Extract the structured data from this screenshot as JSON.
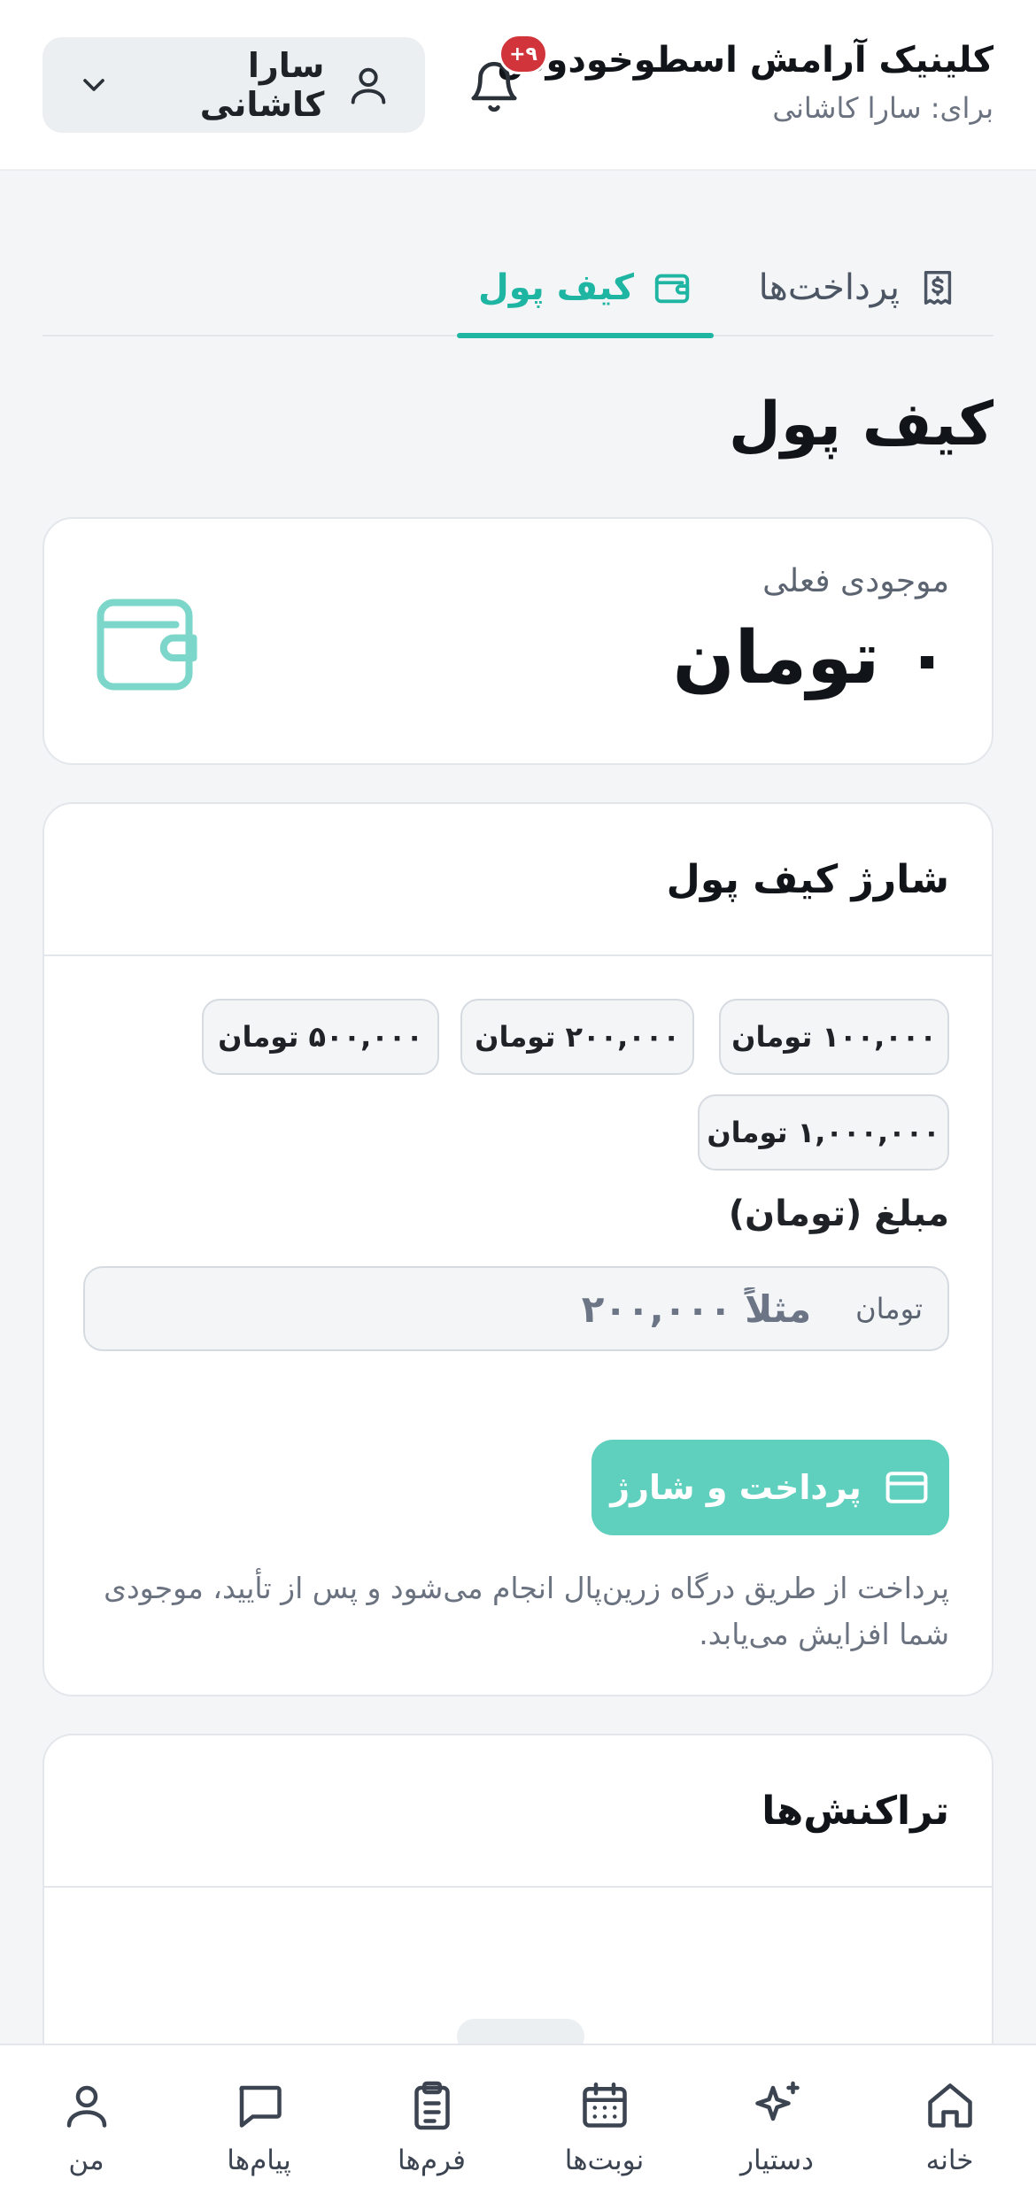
{
  "header": {
    "clinic_name": "کلینیک آرامش اسطوخودوس",
    "for_line": "برای: سارا کاشانی",
    "notification_badge": "۹+",
    "user_name": "سارا کاشانی"
  },
  "tabs": [
    {
      "label": "پرداخت‌ها",
      "icon": "receipt-icon",
      "active": false
    },
    {
      "label": "کیف پول",
      "icon": "wallet-icon",
      "active": true
    }
  ],
  "page_title": "کیف پول",
  "balance": {
    "label": "موجودی فعلی",
    "value": "۰ تومان"
  },
  "charge": {
    "title": "شارژ کیف پول",
    "presets": [
      "۱۰۰,۰۰۰ تومان",
      "۲۰۰,۰۰۰ تومان",
      "۵۰۰,۰۰۰ تومان",
      "۱,۰۰۰,۰۰۰ تومان"
    ],
    "amount_label": "مبلغ (تومان)",
    "amount_placeholder": "مثلاً ۲۰۰,۰۰۰",
    "amount_unit": "تومان",
    "pay_button": "پرداخت و شارژ",
    "note": "پرداخت از طریق درگاه زرین‌پال انجام می‌شود و پس از تأیید، موجودی شما افزایش می‌یابد."
  },
  "transactions": {
    "title": "تراکنش‌ها"
  },
  "bottom_nav": [
    {
      "label": "خانه",
      "icon": "home-icon"
    },
    {
      "label": "دستیار",
      "icon": "sparkles-icon"
    },
    {
      "label": "نوبت‌ها",
      "icon": "calendar-icon"
    },
    {
      "label": "فرم‌ها",
      "icon": "clipboard-icon"
    },
    {
      "label": "پیام‌ها",
      "icon": "chat-icon"
    },
    {
      "label": "من",
      "icon": "user-icon"
    }
  ],
  "colors": {
    "accent": "#1fb5a3",
    "button": "#5fcfbe",
    "badge": "#d1343b",
    "background": "#f3f5f7"
  }
}
